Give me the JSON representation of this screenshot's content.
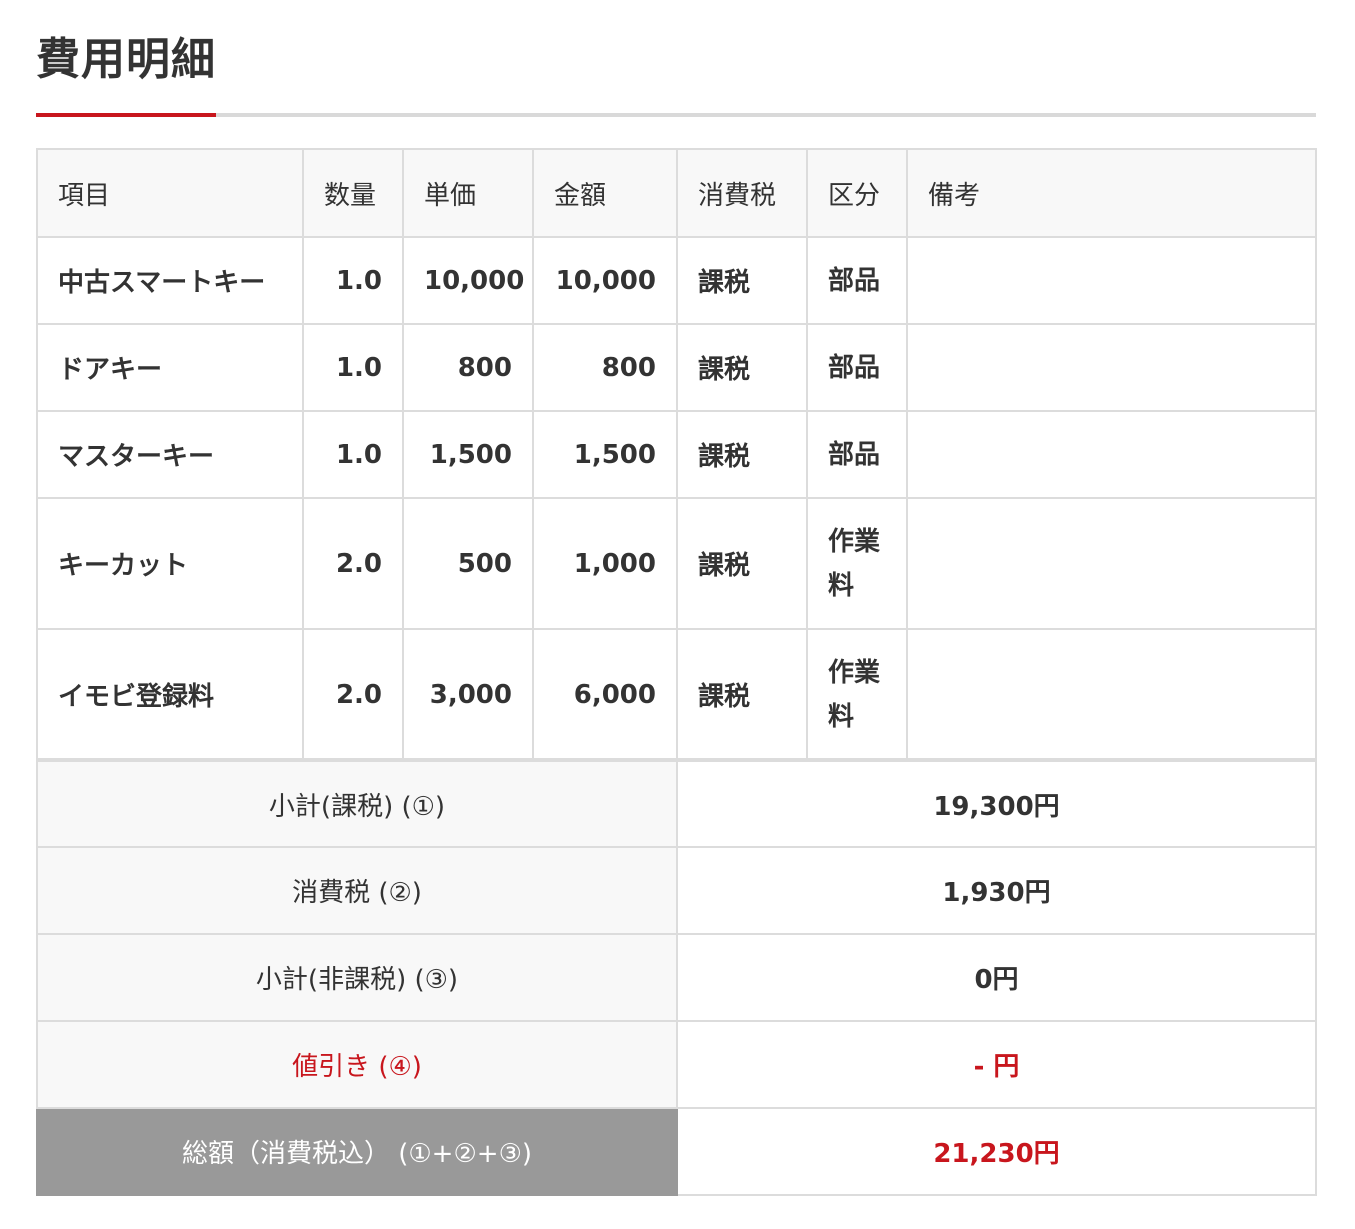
{
  "title": "費用明細",
  "columns": {
    "item": "項目",
    "qty": "数量",
    "unit_price": "単価",
    "amount": "金額",
    "tax": "消費税",
    "category": "区分",
    "note": "備考"
  },
  "rows": [
    {
      "item": "中古スマートキー",
      "qty": "1.0",
      "unit_price": "10,000",
      "amount": "10,000",
      "tax": "課税",
      "category": "部品",
      "note": ""
    },
    {
      "item": "ドアキー",
      "qty": "1.0",
      "unit_price": "800",
      "amount": "800",
      "tax": "課税",
      "category": "部品",
      "note": ""
    },
    {
      "item": "マスターキー",
      "qty": "1.0",
      "unit_price": "1,500",
      "amount": "1,500",
      "tax": "課税",
      "category": "部品",
      "note": ""
    },
    {
      "item": "キーカット",
      "qty": "2.0",
      "unit_price": "500",
      "amount": "1,000",
      "tax": "課税",
      "category": "作業料",
      "note": ""
    },
    {
      "item": "イモビ登録料",
      "qty": "2.0",
      "unit_price": "3,000",
      "amount": "6,000",
      "tax": "課税",
      "category": "作業料",
      "note": ""
    }
  ],
  "summary": {
    "subtotal_taxable": {
      "label": "小計(課税) (①)",
      "value": "19,300円"
    },
    "consumption_tax": {
      "label": "消費税 (②)",
      "value": "1,930円"
    },
    "subtotal_nontaxable": {
      "label": "小計(非課税) (③)",
      "value": "0円"
    },
    "discount": {
      "label": "値引き (④)",
      "value": "- 円"
    },
    "total": {
      "label": "総額（消費税込） (①+②+③)",
      "value": "21,230円"
    }
  },
  "colors": {
    "accent": "#c8161d",
    "header_bg": "#f8f8f8",
    "total_label_bg": "#999999",
    "border": "#dcdcdc"
  }
}
